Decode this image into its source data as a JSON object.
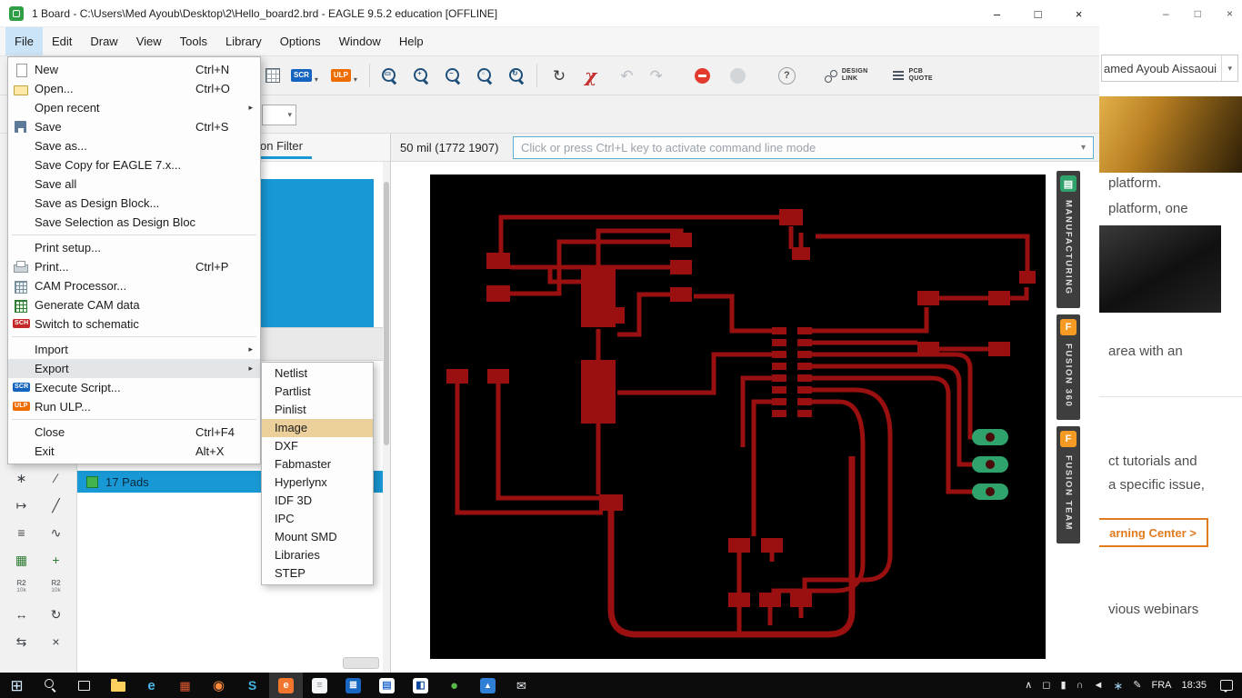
{
  "colors": {
    "selection_blue": "#1899d5",
    "trace_red": "#9a0f0f",
    "pad_green": "#2fa36b",
    "menu_highlight": "#e3e6e9",
    "submenu_highlight": "#ecd09b",
    "manufacturing_green": "#2fa36b",
    "fusion_orange": "#f59a23",
    "learning_orange": "#e07b1f"
  },
  "titlebar": {
    "title": "1 Board - C:\\Users\\Med Ayoub\\Desktop\\2\\Hello_board2.brd - EAGLE 9.5.2 education [OFFLINE]",
    "minimize": "–",
    "maximize": "□",
    "close": "×"
  },
  "menubar": {
    "items": [
      {
        "name": "menubar-file",
        "label": "File",
        "state": "open"
      },
      {
        "name": "menubar-edit",
        "label": "Edit"
      },
      {
        "name": "menubar-draw",
        "label": "Draw"
      },
      {
        "name": "menubar-view",
        "label": "View"
      },
      {
        "name": "menubar-tools",
        "label": "Tools"
      },
      {
        "name": "menubar-library",
        "label": "Library"
      },
      {
        "name": "menubar-options",
        "label": "Options"
      },
      {
        "name": "menubar-window",
        "label": "Window"
      },
      {
        "name": "menubar-help",
        "label": "Help"
      }
    ]
  },
  "file_menu": {
    "items": [
      {
        "name": "menu-item-new",
        "label": "New",
        "shortcut": "Ctrl+N",
        "icon": "new"
      },
      {
        "name": "menu-item-open",
        "label": "Open...",
        "shortcut": "Ctrl+O",
        "icon": "open"
      },
      {
        "name": "menu-item-open-recent",
        "label": "Open recent",
        "arrow": "▸"
      },
      {
        "name": "menu-item-save",
        "label": "Save",
        "shortcut": "Ctrl+S",
        "icon": "save"
      },
      {
        "name": "menu-item-save-as",
        "label": "Save as..."
      },
      {
        "name": "menu-item-save-copy",
        "label": "Save Copy for EAGLE 7.x..."
      },
      {
        "name": "menu-item-save-all",
        "label": "Save all"
      },
      {
        "name": "menu-item-save-as-design-block",
        "label": "Save as Design Block..."
      },
      {
        "name": "menu-item-save-selection-as-design-block",
        "label": "Save Selection as Design Block..."
      },
      {
        "name": "menu-separator",
        "type": "separator"
      },
      {
        "name": "menu-item-print-setup",
        "label": "Print setup..."
      },
      {
        "name": "menu-item-print",
        "label": "Print...",
        "shortcut": "Ctrl+P",
        "icon": "print"
      },
      {
        "name": "menu-item-cam-processor",
        "label": "CAM Processor...",
        "icon": "cam"
      },
      {
        "name": "menu-item-generate-cam-data",
        "label": "Generate CAM data",
        "icon": "gencam"
      },
      {
        "name": "menu-item-switch-to-schematic",
        "label": "Switch to schematic",
        "badge": "SCH"
      },
      {
        "name": "menu-separator",
        "type": "separator"
      },
      {
        "name": "menu-item-import",
        "label": "Import",
        "arrow": "▸"
      },
      {
        "name": "menu-item-export",
        "label": "Export",
        "arrow": "▸",
        "state": "highlighted"
      },
      {
        "name": "menu-item-execute-script",
        "label": "Execute Script...",
        "badge": "SCR"
      },
      {
        "name": "menu-item-run-ulp",
        "label": "Run ULP...",
        "badge": "ULP"
      },
      {
        "name": "menu-separator",
        "type": "separator"
      },
      {
        "name": "menu-item-close",
        "label": "Close",
        "shortcut": "Ctrl+F4"
      },
      {
        "name": "menu-item-exit",
        "label": "Exit",
        "shortcut": "Alt+X"
      }
    ]
  },
  "export_submenu": {
    "items": [
      {
        "name": "submenu-item-netlist",
        "label": "Netlist"
      },
      {
        "name": "submenu-item-partlist",
        "label": "Partlist"
      },
      {
        "name": "submenu-item-pinlist",
        "label": "Pinlist"
      },
      {
        "name": "submenu-item-image",
        "label": "Image",
        "state": "highlighted"
      },
      {
        "name": "submenu-item-dxf",
        "label": "DXF"
      },
      {
        "name": "submenu-item-fabmaster",
        "label": "Fabmaster"
      },
      {
        "name": "submenu-item-hyperlynx",
        "label": "Hyperlynx"
      },
      {
        "name": "submenu-item-idf-3d",
        "label": "IDF 3D"
      },
      {
        "name": "submenu-item-ipc",
        "label": "IPC"
      },
      {
        "name": "submenu-item-mount-smd",
        "label": "Mount SMD"
      },
      {
        "name": "submenu-item-libraries",
        "label": "Libraries"
      },
      {
        "name": "submenu-item-step",
        "label": "STEP"
      }
    ]
  },
  "toolbar": {
    "scr_label": "SCR",
    "ulp_label": "ULP",
    "caret": "▾",
    "zoom_icons": [
      {
        "name": "zoom-fit-button",
        "inner": "▭"
      },
      {
        "name": "zoom-in-button",
        "inner": "+"
      },
      {
        "name": "zoom-out-button",
        "inner": "−"
      },
      {
        "name": "zoom-select-button",
        "inner": "▫"
      },
      {
        "name": "redraw-button",
        "inner": "↻"
      }
    ],
    "rotate_glyph": "↻",
    "chi_symbol": "χ",
    "undo_glyph": "↶",
    "redo_glyph": "↷",
    "help_label": "?",
    "design_link_line1": "DESIGN",
    "design_link_line2": "LINK",
    "pcb_quote_line1": "PCB",
    "pcb_quote_line2": "QUOTE"
  },
  "statusbar": {
    "coords": "50 mil (1772 1907)",
    "command_placeholder": "Click or press Ctrl+L key to activate command line mode"
  },
  "left_panel": {
    "header": "Selection Filter",
    "pads_item": "17 Pads"
  },
  "left_toolbar": {
    "icons": [
      {
        "name": "ratsnest-tool-icon",
        "glyph": "∗",
        "color": "dark"
      },
      {
        "name": "ripup-tool-icon",
        "glyph": "∕",
        "color": "dark"
      },
      {
        "name": "info-tool-icon",
        "glyph": "↦",
        "color": "dark"
      },
      {
        "name": "line-tool-icon",
        "glyph": "╱",
        "color": "dark"
      },
      {
        "name": "signal-tool-icon",
        "glyph": "≡",
        "color": "dark"
      },
      {
        "name": "arc-tool-icon",
        "glyph": "∿",
        "color": "dark"
      },
      {
        "name": "polygon-tool-icon",
        "glyph": "▦",
        "color": "green"
      },
      {
        "name": "via-tool-icon",
        "glyph": "+",
        "color": "green"
      },
      {
        "name": "label-tool-icon",
        "glyph": "R2",
        "sub": "10k",
        "color": "dim",
        "has_sub": "1"
      },
      {
        "name": "value-tool-icon",
        "glyph": "R2",
        "sub": "10k",
        "color": "dim",
        "has_sub": "1"
      },
      {
        "name": "move-tool-icon",
        "glyph": "↔",
        "color": "dark"
      },
      {
        "name": "rotate-tool-icon",
        "glyph": "↻",
        "color": "dark"
      },
      {
        "name": "mirror-tool-icon",
        "glyph": "⇆",
        "color": "dark"
      },
      {
        "name": "delete-tool-icon",
        "glyph": "×",
        "color": "dark"
      }
    ]
  },
  "right_tabs": {
    "items": [
      {
        "name": "manufacturing-tab",
        "label": "MANUFACTURING",
        "kind": "manufacturing",
        "icon_glyph": "▤"
      },
      {
        "name": "fusion-360-tab",
        "label": "FUSION 360",
        "kind": "fusion",
        "icon_glyph": "F"
      },
      {
        "name": "fusion-team-tab",
        "label": "FUSION TEAM",
        "kind": "fusion",
        "icon_glyph": "F"
      }
    ]
  },
  "background_window": {
    "controls": {
      "minimize": "–",
      "maximize": "□",
      "close": "×"
    },
    "account": "amed Ayoub Aissaoui",
    "line1": "platform.",
    "line2": "platform, one",
    "line3": "area with an",
    "line4": "ct tutorials and",
    "line5": "a specific issue,",
    "button": "arning Center  >",
    "line6": "vious webinars"
  },
  "taskbar": {
    "apps": [
      {
        "name": "start-button",
        "kind": "glyph",
        "glyph": "⊞",
        "css": "color:#cfe9fb;font-size:17px"
      },
      {
        "name": "search-button",
        "kind": "mag",
        "glyph": ""
      },
      {
        "name": "task-view-button",
        "kind": "taskview",
        "glyph": ""
      },
      {
        "name": "file-explorer-icon",
        "kind": "folder",
        "glyph": ""
      },
      {
        "name": "edge-icon",
        "kind": "glyph",
        "glyph": "e",
        "css": "color:#4db6e8;font-weight:bold;font-size:15px"
      },
      {
        "name": "office-app-icon",
        "kind": "glyph",
        "glyph": "▦",
        "css": "color:#e05a33"
      },
      {
        "name": "firefox-icon",
        "kind": "glyph",
        "glyph": "◉",
        "css": "color:#ff8a3c;font-size:15px"
      },
      {
        "name": "skype-icon",
        "kind": "glyph",
        "glyph": "S",
        "css": "color:#43b5e5;font-weight:bold;font-size:14px"
      },
      {
        "name": "eagle-taskbar-icon",
        "kind": "badge",
        "glyph": "e",
        "active": true,
        "css": "background:#f2762e;color:#ffffff"
      },
      {
        "name": "document-app-icon",
        "kind": "badge",
        "glyph": "≡",
        "css": "background:#f4f6f8;color:#8a93a0"
      },
      {
        "name": "blue-app-icon",
        "kind": "badge",
        "glyph": "≣",
        "css": "background:#1766c2;color:#ffffff"
      },
      {
        "name": "word-doc-icon",
        "kind": "badge",
        "glyph": "▤",
        "css": "background:#ffffff;color:#2b6fd0"
      },
      {
        "name": "code-app-icon",
        "kind": "badge",
        "glyph": "◧",
        "css": "background:#ffffff;color:#0d47a1"
      },
      {
        "name": "green-app-icon",
        "kind": "glyph",
        "glyph": "●",
        "css": "color:#57b847;font-size:15px"
      },
      {
        "name": "photos-app-icon",
        "kind": "badge",
        "glyph": "▲",
        "css": "background:#2f7fd6;color:#ffffff;font-size:9px"
      },
      {
        "name": "mail-app-icon",
        "kind": "glyph",
        "glyph": "✉",
        "css": "color:#e6edf4"
      }
    ],
    "tray": {
      "icons": [
        {
          "name": "hidden-icons-chevron",
          "glyph": "∧"
        },
        {
          "name": "display-icon",
          "glyph": "◻"
        },
        {
          "name": "battery-icon",
          "glyph": "▮"
        },
        {
          "name": "wifi-icon",
          "glyph": "∩"
        },
        {
          "name": "volume-icon",
          "glyph": "◄"
        },
        {
          "name": "sync-icon",
          "glyph": "∗",
          "css": "color:#9ed1f2;font-size:13px"
        },
        {
          "name": "pen-icon",
          "glyph": "✎"
        }
      ],
      "lang": "FRA",
      "time": "18:35"
    }
  }
}
